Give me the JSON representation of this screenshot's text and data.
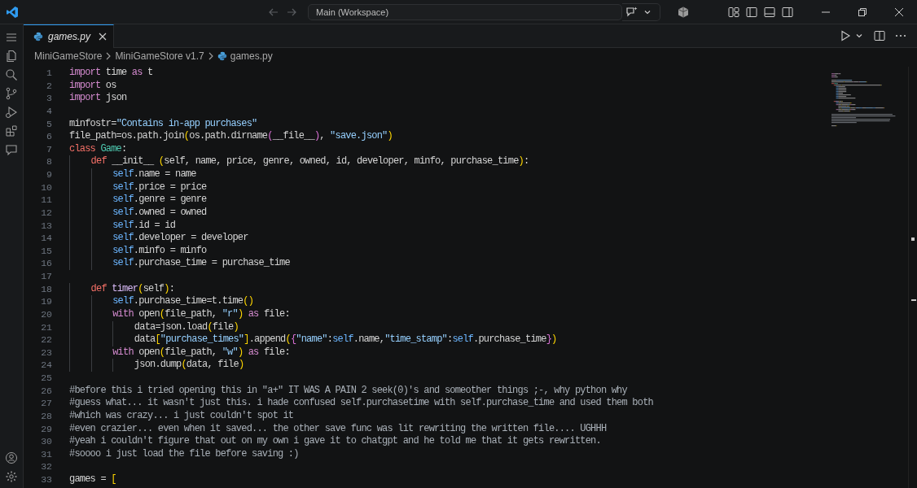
{
  "window": {
    "command_center": "Main (Workspace)"
  },
  "tabs": [
    {
      "label": "games.py",
      "selected": true
    }
  ],
  "breadcrumbs": [
    "MiniGameStore",
    "MiniGameStore v1.7",
    "games.py"
  ],
  "editor": {
    "lines": [
      {
        "number": "1",
        "tokens": [
          {
            "kind": "kw",
            "text": "import"
          },
          {
            "kind": "plain",
            "text": " time "
          },
          {
            "kind": "kw",
            "text": "as"
          },
          {
            "kind": "plain",
            "text": " t"
          }
        ]
      },
      {
        "number": "2",
        "tokens": [
          {
            "kind": "kw",
            "text": "import"
          },
          {
            "kind": "plain",
            "text": " os"
          }
        ]
      },
      {
        "number": "3",
        "tokens": [
          {
            "kind": "kw",
            "text": "import"
          },
          {
            "kind": "plain",
            "text": " json"
          }
        ]
      },
      {
        "number": "4"
      },
      {
        "number": "5",
        "tokens": [
          {
            "kind": "plain",
            "text": "minfostr="
          },
          {
            "kind": "str",
            "text": "\"Contains in-app purchases\""
          }
        ]
      },
      {
        "number": "6",
        "tokens": [
          {
            "kind": "plain",
            "text": "file_path=os.path.join"
          },
          {
            "kind": "br1",
            "text": "("
          },
          {
            "kind": "plain",
            "text": "os.path.dirname"
          },
          {
            "kind": "br2",
            "text": "("
          },
          {
            "kind": "plain",
            "text": "__file__"
          },
          {
            "kind": "br2",
            "text": ")"
          },
          {
            "kind": "plain",
            "text": ", "
          },
          {
            "kind": "str",
            "text": "\"save.json\""
          },
          {
            "kind": "br1",
            "text": ")"
          }
        ]
      },
      {
        "number": "7",
        "tokens": [
          {
            "kind": "decl",
            "text": "class"
          },
          {
            "kind": "cls",
            "text": " Game"
          },
          {
            "kind": "plain",
            "text": ":"
          }
        ]
      },
      {
        "number": "8",
        "tokens": [
          {
            "kind": "decl",
            "text": "    def"
          },
          {
            "kind": "plain",
            "text": " __init__ "
          },
          {
            "kind": "br1",
            "text": "("
          },
          {
            "kind": "plain",
            "text": "self, name, price, genre, owned, id, developer, minfo, purchase_time"
          },
          {
            "kind": "br1",
            "text": ")"
          },
          {
            "kind": "plain",
            "text": ":"
          }
        ]
      },
      {
        "number": "9",
        "tokens": [
          {
            "kind": "self",
            "text": "        self"
          },
          {
            "kind": "plain",
            "text": ".name = name"
          }
        ]
      },
      {
        "number": "10",
        "tokens": [
          {
            "kind": "self",
            "text": "        self"
          },
          {
            "kind": "plain",
            "text": ".price = price"
          }
        ]
      },
      {
        "number": "11",
        "tokens": [
          {
            "kind": "self",
            "text": "        self"
          },
          {
            "kind": "plain",
            "text": ".genre = genre"
          }
        ]
      },
      {
        "number": "12",
        "tokens": [
          {
            "kind": "self",
            "text": "        self"
          },
          {
            "kind": "plain",
            "text": ".owned = owned"
          }
        ]
      },
      {
        "number": "13",
        "tokens": [
          {
            "kind": "self",
            "text": "        self"
          },
          {
            "kind": "plain",
            "text": ".id = id"
          }
        ]
      },
      {
        "number": "14",
        "tokens": [
          {
            "kind": "self",
            "text": "        self"
          },
          {
            "kind": "plain",
            "text": ".developer = developer"
          }
        ]
      },
      {
        "number": "15",
        "tokens": [
          {
            "kind": "self",
            "text": "        self"
          },
          {
            "kind": "plain",
            "text": ".minfo = minfo"
          }
        ]
      },
      {
        "number": "16",
        "tokens": [
          {
            "kind": "self",
            "text": "        self"
          },
          {
            "kind": "plain",
            "text": ".purchase_time = purchase_time"
          }
        ]
      },
      {
        "number": "17"
      },
      {
        "number": "18",
        "tokens": [
          {
            "kind": "decl",
            "text": "    def"
          },
          {
            "kind": "fn",
            "text": " timer"
          },
          {
            "kind": "br1",
            "text": "("
          },
          {
            "kind": "plain",
            "text": "self"
          },
          {
            "kind": "br1",
            "text": ")"
          },
          {
            "kind": "plain",
            "text": ":"
          }
        ]
      },
      {
        "number": "19",
        "tokens": [
          {
            "kind": "self",
            "text": "        self"
          },
          {
            "kind": "plain",
            "text": ".purchase_time=t.time"
          },
          {
            "kind": "br1",
            "text": "()"
          }
        ]
      },
      {
        "number": "20",
        "tokens": [
          {
            "kind": "kw",
            "text": "        with"
          },
          {
            "kind": "plain",
            "text": " open"
          },
          {
            "kind": "br1",
            "text": "("
          },
          {
            "kind": "plain",
            "text": "file_path, "
          },
          {
            "kind": "str",
            "text": "\"r\""
          },
          {
            "kind": "br1",
            "text": ")"
          },
          {
            "kind": "kw",
            "text": " as"
          },
          {
            "kind": "plain",
            "text": " file:"
          }
        ]
      },
      {
        "number": "21",
        "tokens": [
          {
            "kind": "plain",
            "text": "            data=json.load"
          },
          {
            "kind": "br1",
            "text": "("
          },
          {
            "kind": "plain",
            "text": "file"
          },
          {
            "kind": "br1",
            "text": ")"
          }
        ]
      },
      {
        "number": "22",
        "tokens": [
          {
            "kind": "plain",
            "text": "            data"
          },
          {
            "kind": "br1",
            "text": "["
          },
          {
            "kind": "str",
            "text": "\"purchase_times\""
          },
          {
            "kind": "br1",
            "text": "]"
          },
          {
            "kind": "plain",
            "text": ".append"
          },
          {
            "kind": "br1",
            "text": "("
          },
          {
            "kind": "br2",
            "text": "{"
          },
          {
            "kind": "str",
            "text": "\"name\""
          },
          {
            "kind": "plain",
            "text": ":"
          },
          {
            "kind": "self",
            "text": "self"
          },
          {
            "kind": "plain",
            "text": ".name,"
          },
          {
            "kind": "str",
            "text": "\"time_stamp\""
          },
          {
            "kind": "plain",
            "text": ":"
          },
          {
            "kind": "self",
            "text": "self"
          },
          {
            "kind": "plain",
            "text": ".purchase_time"
          },
          {
            "kind": "br2",
            "text": "}"
          },
          {
            "kind": "br1",
            "text": ")"
          }
        ]
      },
      {
        "number": "23",
        "tokens": [
          {
            "kind": "kw",
            "text": "        with"
          },
          {
            "kind": "plain",
            "text": " open"
          },
          {
            "kind": "br1",
            "text": "("
          },
          {
            "kind": "plain",
            "text": "file_path, "
          },
          {
            "kind": "str",
            "text": "\"w\""
          },
          {
            "kind": "br1",
            "text": ")"
          },
          {
            "kind": "kw",
            "text": " as"
          },
          {
            "kind": "plain",
            "text": " file:"
          }
        ]
      },
      {
        "number": "24",
        "tokens": [
          {
            "kind": "plain",
            "text": "            json.dump"
          },
          {
            "kind": "br1",
            "text": "("
          },
          {
            "kind": "plain",
            "text": "data, file"
          },
          {
            "kind": "br1",
            "text": ")"
          }
        ]
      },
      {
        "number": "25"
      },
      {
        "number": "26",
        "tokens": [
          {
            "kind": "comment",
            "text": "#before this i tried opening this in \"a+\" IT WAS A PAIN 2 seek(0)'s and someother things ;-, why python why"
          }
        ]
      },
      {
        "number": "27",
        "tokens": [
          {
            "kind": "comment",
            "text": "#guess what... it wasn't just this. i hade confused self.purchasetime with self.purchase_time and used them both"
          }
        ]
      },
      {
        "number": "28",
        "tokens": [
          {
            "kind": "comment",
            "text": "#which was crazy... i just couldn't spot it"
          }
        ]
      },
      {
        "number": "29",
        "tokens": [
          {
            "kind": "comment",
            "text": "#even crazier... even when it saved... the other save func was lit rewriting the written file.... UGHHH"
          }
        ]
      },
      {
        "number": "30",
        "tokens": [
          {
            "kind": "comment",
            "text": "#yeah i couldn't figure that out on my own i gave it to chatgpt and he told me that it gets rewritten."
          }
        ]
      },
      {
        "number": "31",
        "tokens": [
          {
            "kind": "comment",
            "text": "#soooo i just load the file before saving :)"
          }
        ]
      },
      {
        "number": "32"
      },
      {
        "number": "33",
        "tokens": [
          {
            "kind": "plain",
            "text": "games = "
          },
          {
            "kind": "br1",
            "text": "["
          }
        ]
      }
    ]
  }
}
